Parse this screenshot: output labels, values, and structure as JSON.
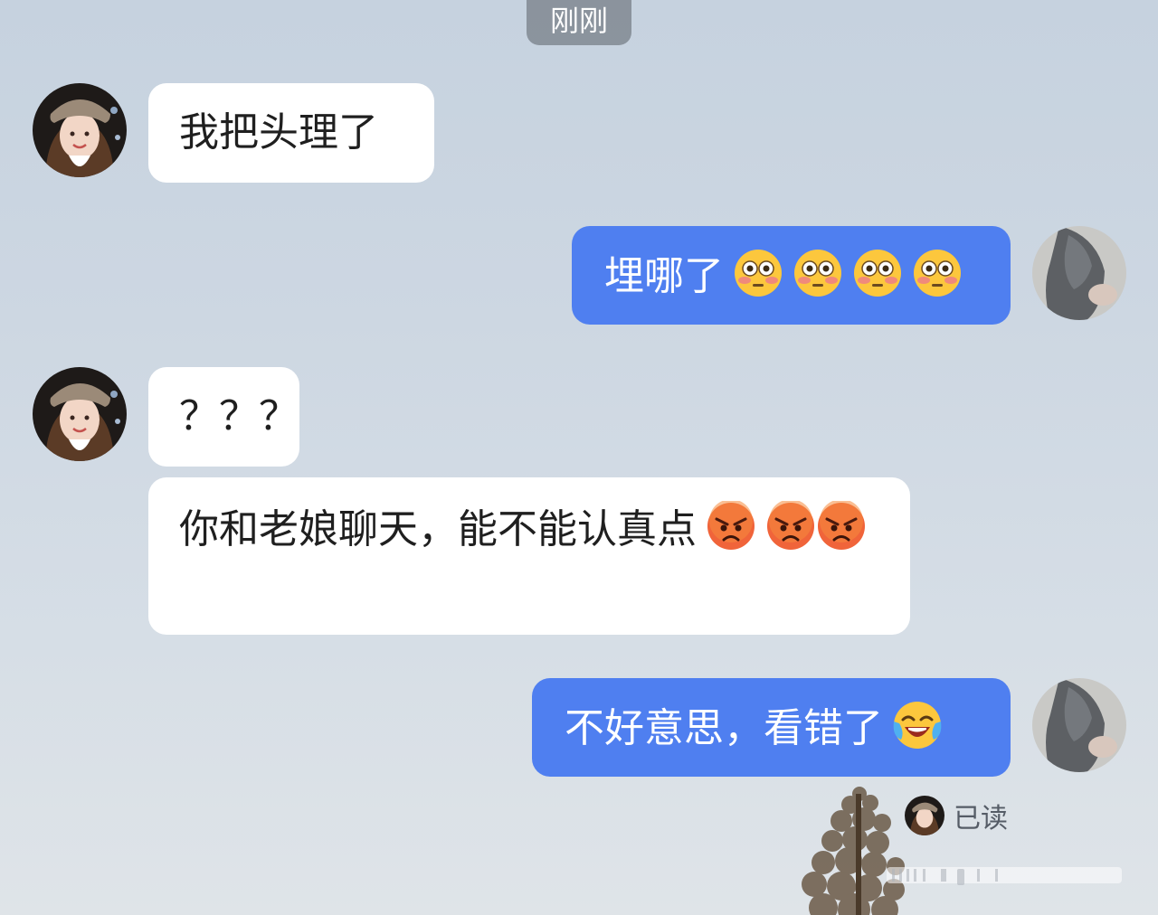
{
  "timestamp": "刚刚",
  "messages": [
    {
      "side": "in",
      "text": "我把头理了"
    },
    {
      "side": "out",
      "text": "埋哪了",
      "emojis": [
        "flushed-face",
        "flushed-face",
        "flushed-face",
        "flushed-face"
      ]
    },
    {
      "side": "in",
      "text": "？？？"
    },
    {
      "side": "in",
      "text": "你和老娘聊天，能不能认真点",
      "emojis": [
        "angry-face",
        "angry-face",
        "angry-face"
      ]
    },
    {
      "side": "out",
      "text": "不好意思，看错了",
      "emojis": [
        "crying-laughing-face"
      ]
    }
  ],
  "read_status": "已读",
  "colors": {
    "outgoing_bubble": "#4f7ff0",
    "incoming_bubble": "#ffffff"
  }
}
